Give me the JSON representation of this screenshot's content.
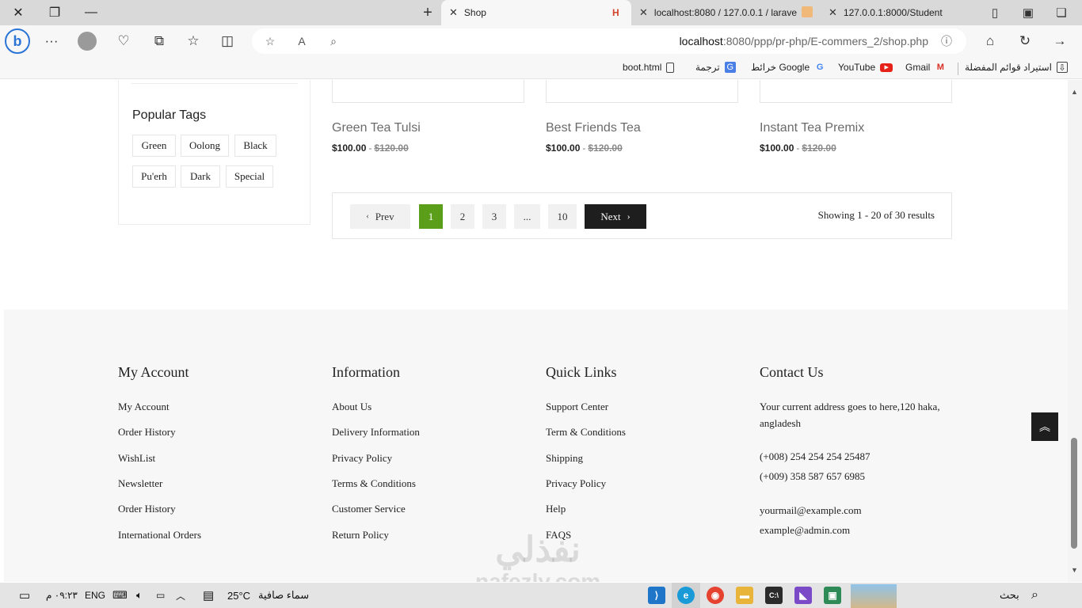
{
  "browser": {
    "tabs": [
      {
        "title": "Shop",
        "active": true
      },
      {
        "title": "localhost:8080 / 127.0.0.1 / larave",
        "active": false
      },
      {
        "title": "127.0.0.1:8000/Student",
        "active": false
      }
    ],
    "url_host": "localhost",
    "url_rest": ":8080/ppp/pr-php/E-commers_2/shop.php",
    "bookmarks": [
      {
        "label": "استيراد قوائم المفضلة"
      },
      {
        "label": "Gmail"
      },
      {
        "label": "YouTube"
      },
      {
        "label": "خرائط Google"
      },
      {
        "label": "ترجمة"
      },
      {
        "label": "boot.html"
      }
    ]
  },
  "sidebar": {
    "popular_tags_title": "Popular Tags",
    "tags": [
      "Green",
      "Oolong",
      "Black",
      "Pu'erh",
      "Dark",
      "Special"
    ]
  },
  "products": [
    {
      "name": "Green Tea Tulsi",
      "price": "$100.00",
      "old_price": "$120.00"
    },
    {
      "name": "Best Friends Tea",
      "price": "$100.00",
      "old_price": "$120.00"
    },
    {
      "name": "Instant Tea Premix",
      "price": "$100.00",
      "old_price": "$120.00"
    }
  ],
  "pagination": {
    "prev": "Prev",
    "pages": [
      "1",
      "2",
      "3",
      "...",
      "10"
    ],
    "next": "Next",
    "current_page": "1",
    "showing": "Showing 1 - 20 of 30 results"
  },
  "footer": {
    "my_account": {
      "title": "My Account",
      "links": [
        "My Account",
        "Order History",
        "WishList",
        "Newsletter",
        "Order History",
        "International Orders"
      ]
    },
    "information": {
      "title": "Information",
      "links": [
        "About Us",
        "Delivery Information",
        "Privacy Policy",
        "Terms & Conditions",
        "Customer Service",
        "Return Policy"
      ]
    },
    "quick_links": {
      "title": "Quick Links",
      "links": [
        "Support Center",
        "Term & Conditions",
        "Shipping",
        "Privacy Policy",
        "Help",
        "FAQS"
      ]
    },
    "contact": {
      "title": "Contact Us",
      "address": "Your current address goes to here,120 haka, angladesh",
      "phone1": "(+008) 254 254 254 25487",
      "phone2": "(+009) 358 587 657 6985",
      "email1": "yourmail@example.com",
      "email2": "example@admin.com"
    }
  },
  "watermark": {
    "arabic": "نفذلي",
    "latin": "nafezly.com"
  },
  "taskbar": {
    "search_label": "بحث",
    "weather_temp": "25°C",
    "weather_text": "سماء صافية",
    "language": "ENG",
    "clock": "٠٩:٢٣ م"
  },
  "colors": {
    "accent_green": "#5a9e1a",
    "dark_button": "#1e1e1e"
  }
}
